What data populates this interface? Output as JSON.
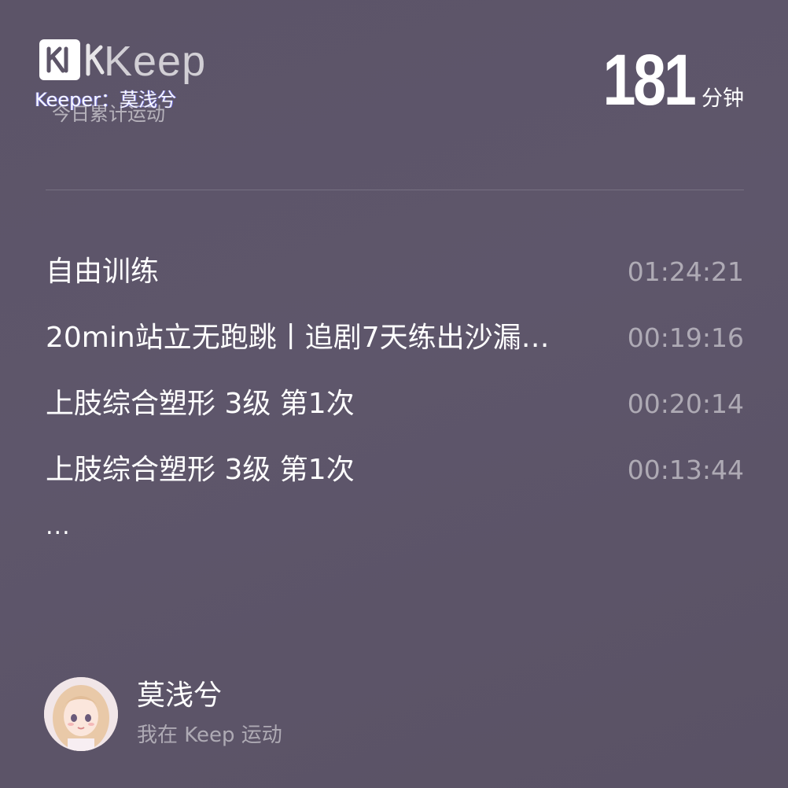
{
  "brand": {
    "logo_icon": "keep-logo-icon",
    "wordmark": "Keep",
    "subtitle": "今日累计运动",
    "keeper_line": "Keeper：莫浅兮"
  },
  "total": {
    "value": "181",
    "unit": "分钟"
  },
  "workouts": [
    {
      "name": "自由训练",
      "duration": "01:24:21"
    },
    {
      "name": "20min站立无跑跳丨追剧7天练出沙漏…",
      "duration": "00:19:16"
    },
    {
      "name": "上肢综合塑形 3级 第1次",
      "duration": "00:20:14"
    },
    {
      "name": "上肢综合塑形 3级 第1次",
      "duration": "00:13:44"
    }
  ],
  "more_indicator": "...",
  "user": {
    "avatar_icon": "user-avatar",
    "name": "莫浅兮",
    "caption": "我在 Keep 运动"
  },
  "colors": {
    "background": "#5d5568",
    "text_primary": "#ffffff",
    "text_secondary": "rgba(255,255,255,0.5)",
    "divider": "rgba(255,255,255,0.16)"
  }
}
